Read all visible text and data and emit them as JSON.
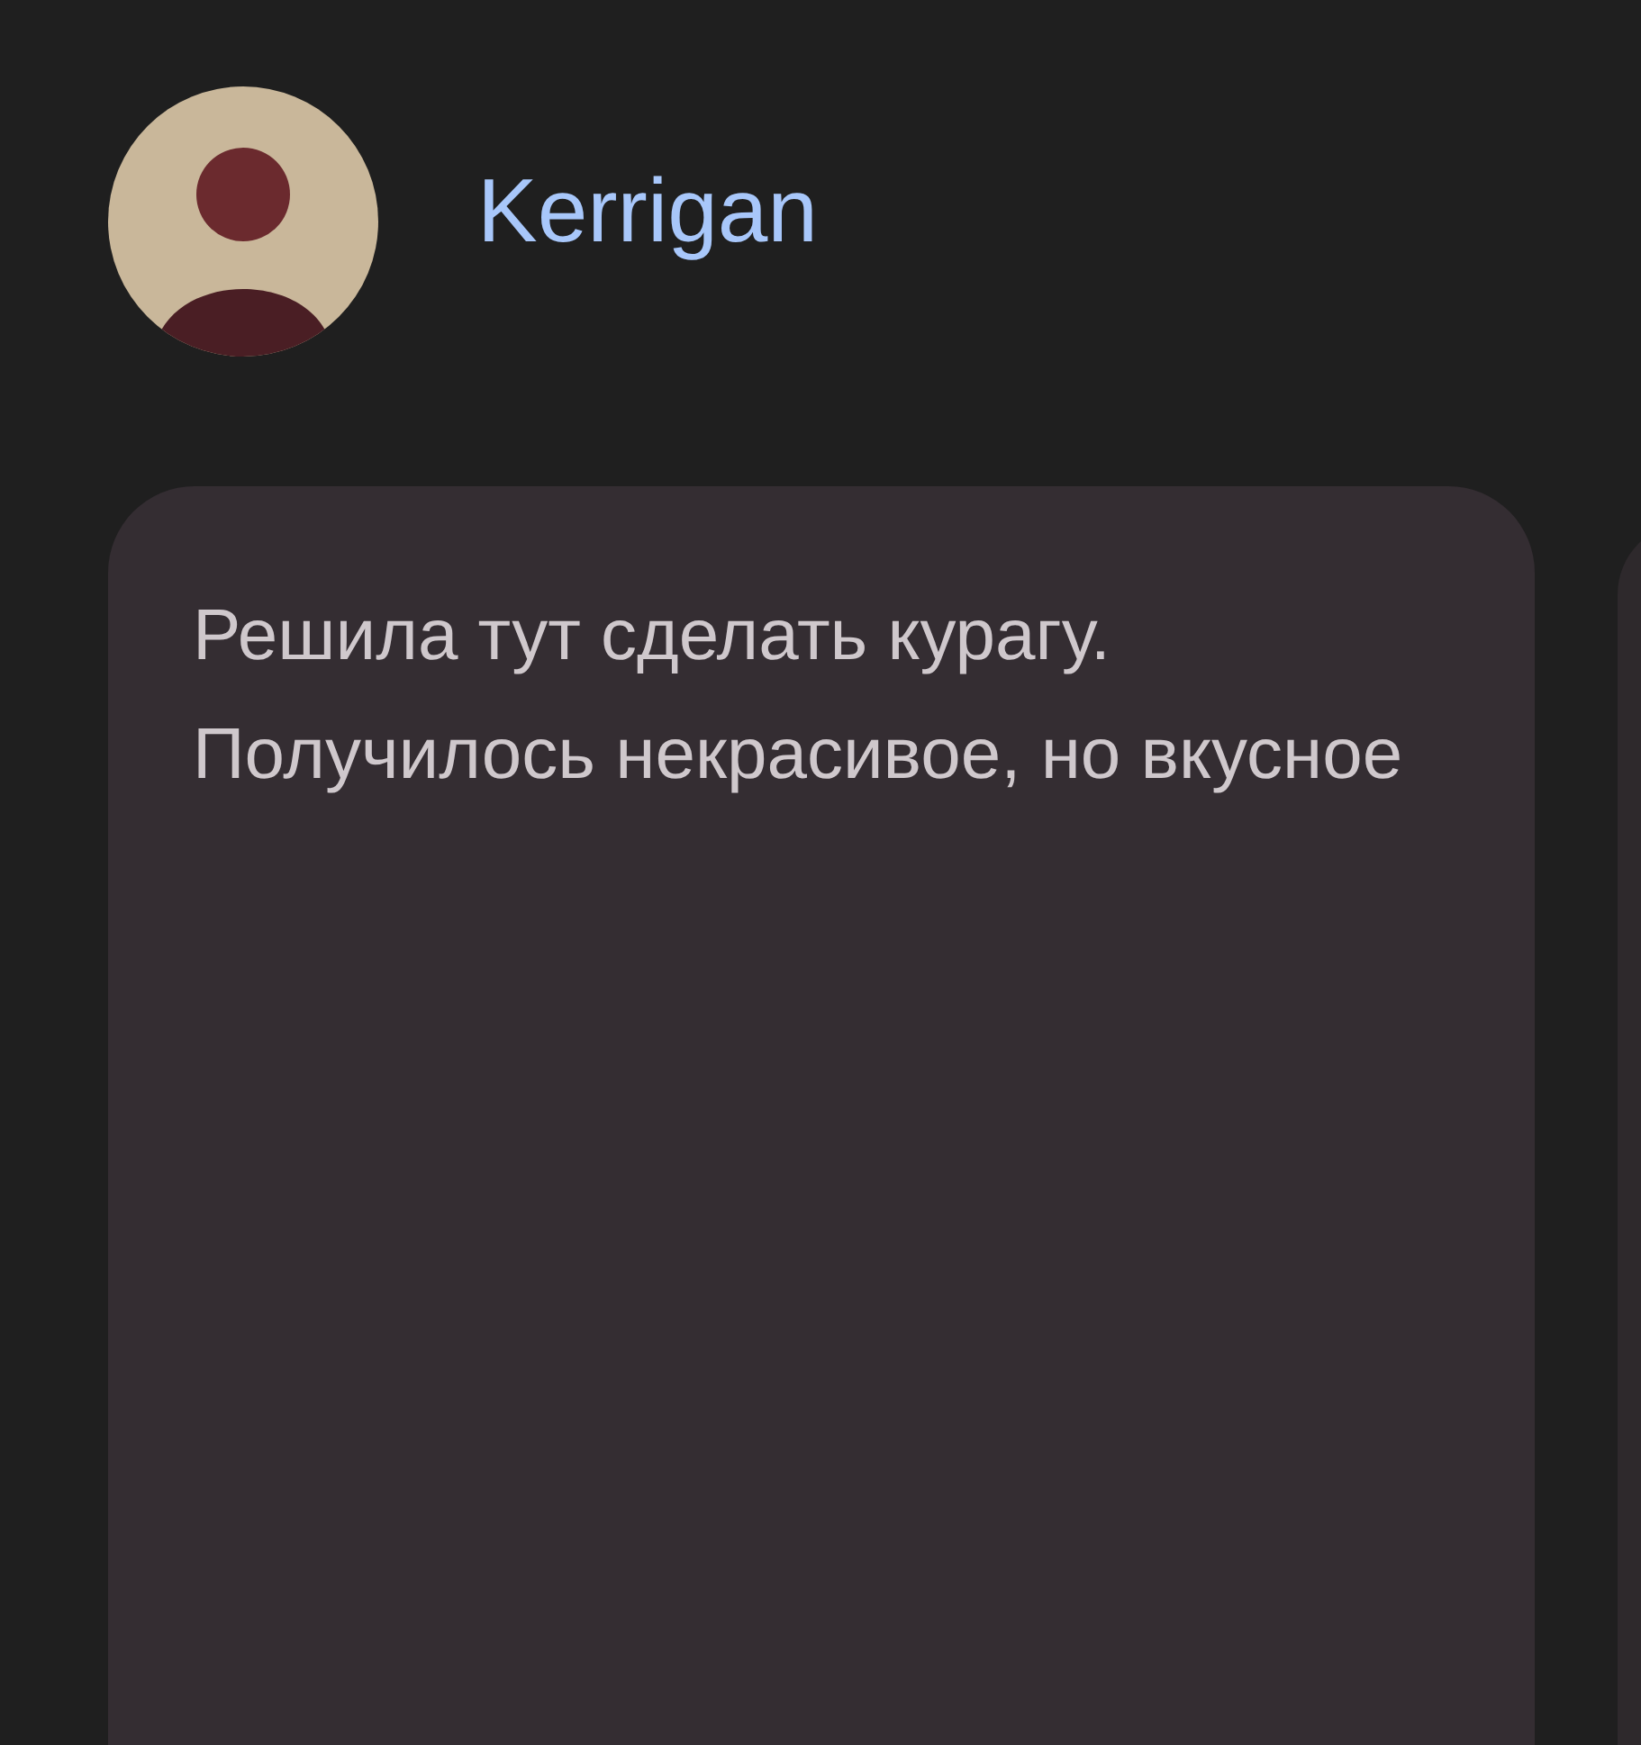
{
  "post": {
    "author": "Kerrigan",
    "text": "Решила тут сделать курагу. Получилось некрасивое, но вкусное"
  }
}
